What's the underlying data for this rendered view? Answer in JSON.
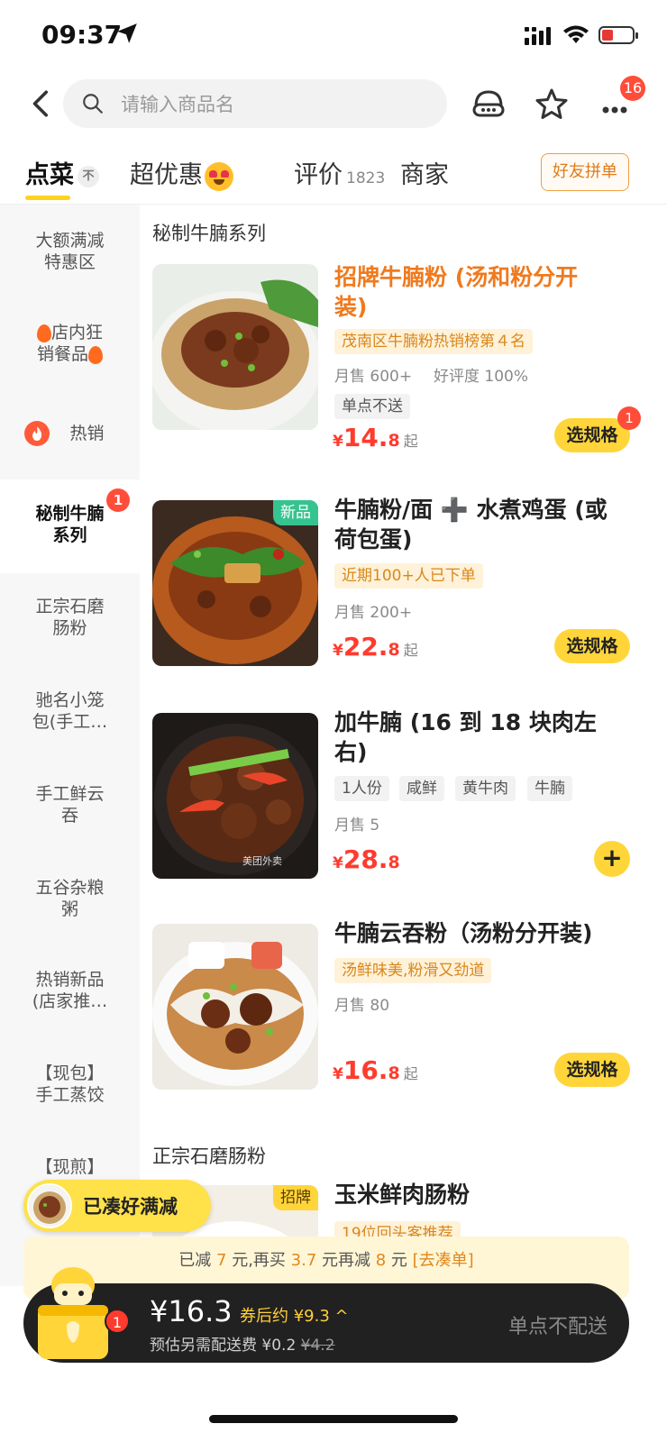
{
  "status": {
    "time": "09:37"
  },
  "nav": {
    "search_placeholder": "请输入商品名",
    "more_badge": "16"
  },
  "tabs": [
    {
      "label": "点菜",
      "badge": "不"
    },
    {
      "label": "超优惠"
    },
    {
      "label": "评价",
      "count": "1823"
    },
    {
      "label": "商家"
    }
  ],
  "group_order_label": "好友拼单",
  "sidebar": {
    "items": [
      {
        "line1": "大额满减",
        "line2": "特惠区"
      },
      {
        "line1": "店内狂",
        "line2": "销餐品"
      },
      {
        "label": "热销"
      },
      {
        "line1": "秘制牛腩",
        "line2": "系列",
        "badge": "1"
      },
      {
        "line1": "正宗石磨",
        "line2": "肠粉"
      },
      {
        "line1": "驰名小笼",
        "line2": "包(手工…"
      },
      {
        "line1": "手工鲜云",
        "line2": "吞"
      },
      {
        "line1": "五谷杂粮",
        "line2": "粥"
      },
      {
        "line1": "热销新品",
        "line2": "(店家推…"
      },
      {
        "line1": "【现包】",
        "line2": "手工蒸饺"
      },
      {
        "line1": "【现煎】",
        "line2": ""
      }
    ]
  },
  "sections": [
    {
      "title": "秘制牛腩系列"
    },
    {
      "title": "正宗石磨肠粉"
    }
  ],
  "dishes": [
    {
      "name_line1": "招牌牛腩粉 (汤和粉分开",
      "name_line2": "装)",
      "rank_tag": "茂南区牛腩粉热销榜第４名",
      "sales": "月售 600+",
      "rating": "好评度 100%",
      "gray_tag": "单点不送",
      "currency": "¥",
      "price_int": "14.",
      "price_dec": "8",
      "price_suffix": "起",
      "button": "选规格",
      "button_badge": "1"
    },
    {
      "name_line1": "牛腩粉/面 ➕ 水煮鸡蛋 (或",
      "name_line2": "荷包蛋)",
      "new_tag": "新品",
      "rank_tag": "近期100+人已下单",
      "sales": "月售 200+",
      "currency": "¥",
      "price_int": "22.",
      "price_dec": "8",
      "price_suffix": "起",
      "button": "选规格"
    },
    {
      "name_line1": "加牛腩 (16 到 18 块肉左",
      "name_line2": "右)",
      "tags": [
        "1人份",
        "咸鲜",
        "黄牛肉",
        "牛腩"
      ],
      "sales": "月售 5",
      "currency": "¥",
      "price_int": "28.",
      "price_dec": "8",
      "watermark": "美团外卖",
      "button": "+"
    },
    {
      "name_line1": "牛腩云吞粉（汤粉分开装)",
      "rank_tag": "汤鲜味美,粉滑又劲道",
      "sales": "月售 80",
      "currency": "¥",
      "price_int": "16.",
      "price_dec": "8",
      "price_suffix": "起",
      "button": "选规格"
    },
    {
      "name_line1": "玉米鲜肉肠粉",
      "sign_tag": "招牌",
      "rank_tag": "19位回头客推荐"
    }
  ],
  "float_pill": {
    "label": "已凑好满减"
  },
  "promo": {
    "part1": "已减 ",
    "amount1": "7",
    "part2": " 元,再买 ",
    "amount2": "3.7",
    "part3": " 元再减 ",
    "amount3": "8",
    "part4": " 元 ",
    "link": "[去凑单]"
  },
  "cart": {
    "price": "¥16.3",
    "after_discount": "券后约 ¥9.3 ^",
    "fee_label": "预估另需配送费 ¥0.2 ",
    "fee_original": "¥4.2",
    "no_deliver": "单点不配送",
    "badge": "1"
  },
  "colors": {
    "brand_yellow": "#ffd53a",
    "price_red": "#ff3b2e",
    "orange": "#f07a1e",
    "tag_bg": "#fff2d9"
  }
}
